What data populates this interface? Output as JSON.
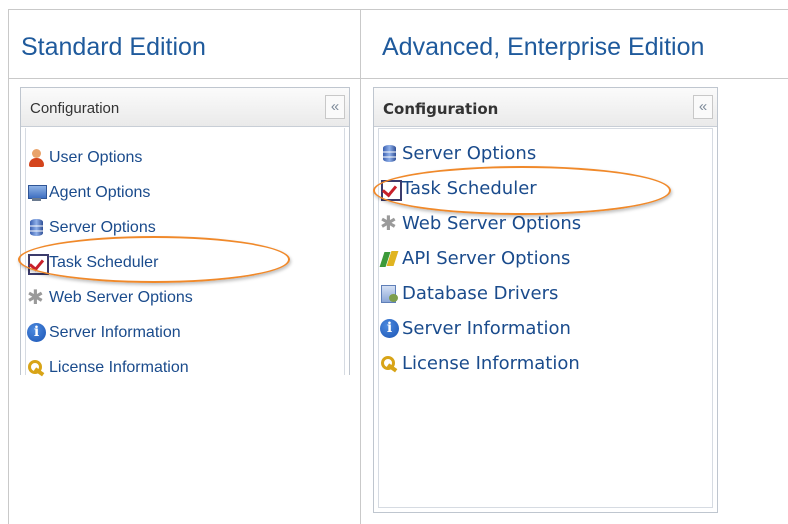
{
  "columns": {
    "left_header": "Standard Edition",
    "right_header": "Advanced, Enterprise Edition"
  },
  "standard_panel": {
    "title": "Configuration",
    "collapse_glyph": "«",
    "items": [
      {
        "label": "User Options",
        "icon": "user-icon"
      },
      {
        "label": "Agent Options",
        "icon": "agent-icon"
      },
      {
        "label": "Server Options",
        "icon": "server-icon"
      },
      {
        "label": "Task Scheduler",
        "icon": "task-scheduler-icon"
      },
      {
        "label": "Web Server Options",
        "icon": "web-server-icon"
      },
      {
        "label": "Server Information",
        "icon": "info-icon"
      },
      {
        "label": "License Information",
        "icon": "key-icon"
      }
    ]
  },
  "advanced_panel": {
    "title": "Configuration",
    "collapse_glyph": "«",
    "items": [
      {
        "label": "Server Options",
        "icon": "server-icon"
      },
      {
        "label": "Task Scheduler",
        "icon": "task-scheduler-icon"
      },
      {
        "label": "Web Server Options",
        "icon": "web-server-icon"
      },
      {
        "label": "API Server Options",
        "icon": "api-server-icon"
      },
      {
        "label": "Database Drivers",
        "icon": "database-drivers-icon"
      },
      {
        "label": "Server Information",
        "icon": "info-icon"
      },
      {
        "label": "License Information",
        "icon": "key-icon"
      }
    ]
  },
  "colors": {
    "header_text": "#1f5a9c",
    "link_text": "#1a4b8c",
    "highlight": "#f0892a"
  }
}
